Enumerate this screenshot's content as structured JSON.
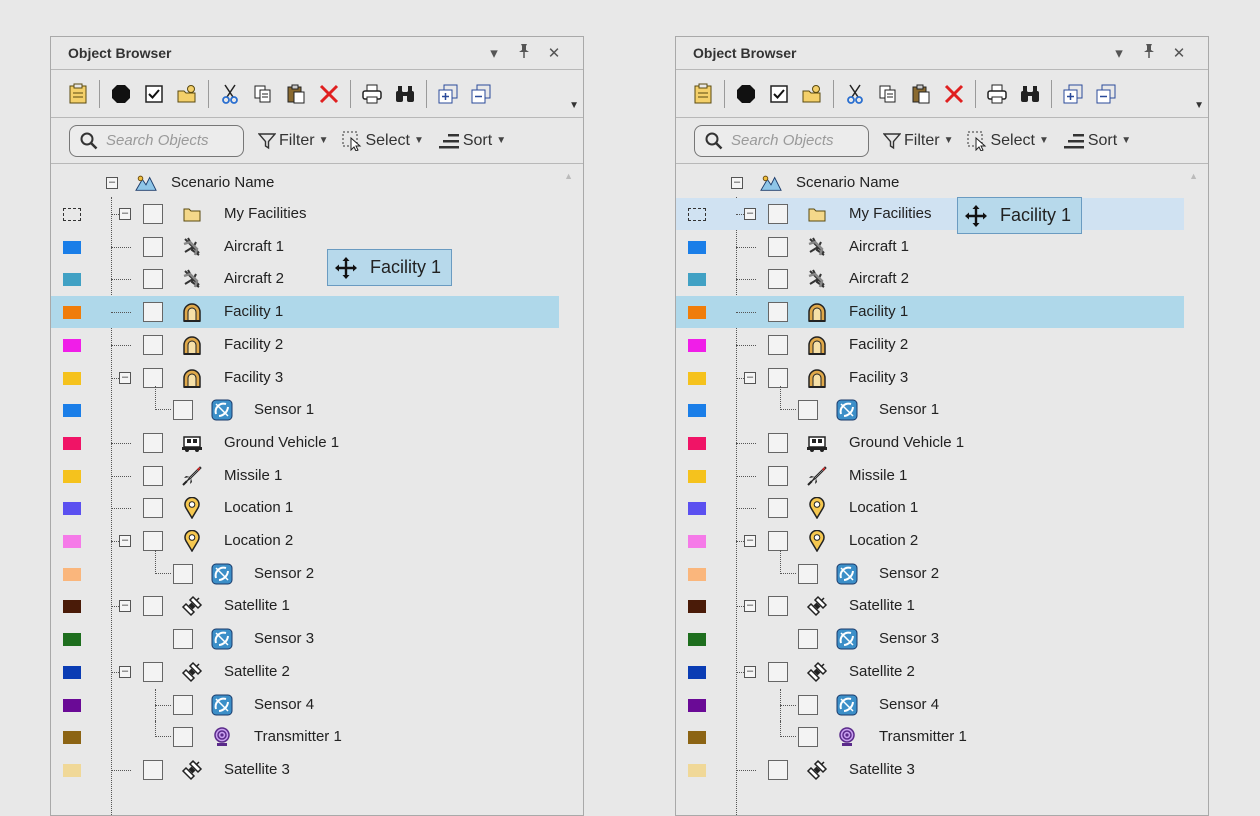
{
  "panels": [
    {
      "title": "Object Browser",
      "search_placeholder": "Search Objects",
      "filter_label": "Filter",
      "select_label": "Select",
      "sort_label": "Sort",
      "drag_label": "Facility 1",
      "hovered_row": null,
      "selected_row": 3
    },
    {
      "title": "Object Browser",
      "search_placeholder": "Search Objects",
      "filter_label": "Filter",
      "select_label": "Select",
      "sort_label": "Sort",
      "drag_label": "Facility 1",
      "hovered_row": 0,
      "selected_row": 3
    }
  ],
  "toolbar_icons": [
    "properties-icon",
    "stop-icon",
    "checkbox-icon",
    "new-folder-icon",
    "cut-icon",
    "copy-icon",
    "paste-icon",
    "delete-icon",
    "print-icon",
    "find-icon",
    "expand-all-icon",
    "collapse-all-icon"
  ],
  "tree": {
    "root": {
      "label": "Scenario Name",
      "icon": "scenario-icon"
    },
    "rows": [
      {
        "label": "My Facilities",
        "icon": "folder-icon",
        "color": "none",
        "level": 1,
        "expander": true
      },
      {
        "label": "Aircraft 1",
        "icon": "aircraft-icon",
        "color": "#1a7ee8",
        "level": 1,
        "expander": false
      },
      {
        "label": "Aircraft 2",
        "icon": "aircraft-icon",
        "color": "#41a1c4",
        "level": 1,
        "expander": false
      },
      {
        "label": "Facility 1",
        "icon": "facility-icon",
        "color": "#f07d0a",
        "level": 1,
        "expander": false
      },
      {
        "label": "Facility 2",
        "icon": "facility-icon",
        "color": "#f01ee8",
        "level": 1,
        "expander": false
      },
      {
        "label": "Facility 3",
        "icon": "facility-icon",
        "color": "#f5c21d",
        "level": 1,
        "expander": true
      },
      {
        "label": "Sensor 1",
        "icon": "sensor-icon",
        "color": "#1a7ee8",
        "level": 2,
        "expander": false,
        "last": true
      },
      {
        "label": "Ground Vehicle 1",
        "icon": "ground-vehicle-icon",
        "color": "#f01466",
        "level": 1,
        "expander": false
      },
      {
        "label": "Missile 1",
        "icon": "missile-icon",
        "color": "#f5c21d",
        "level": 1,
        "expander": false
      },
      {
        "label": "Location 1",
        "icon": "location-icon",
        "color": "#5b50f0",
        "level": 1,
        "expander": false
      },
      {
        "label": "Location 2",
        "icon": "location-icon",
        "color": "#f57ae8",
        "level": 1,
        "expander": true
      },
      {
        "label": "Sensor 2",
        "icon": "sensor-icon",
        "color": "#fab67c",
        "level": 2,
        "expander": false,
        "last": true
      },
      {
        "label": "Satellite 1",
        "icon": "satellite-icon",
        "color": "#4a1b08",
        "level": 1,
        "expander": true
      },
      {
        "label": "Sensor 3",
        "icon": "sensor-icon",
        "color": "#1e6e1e",
        "level": 2,
        "expander": false,
        "nolink": true
      },
      {
        "label": "Satellite 2",
        "icon": "satellite-icon",
        "color": "#0a3cb4",
        "level": 1,
        "expander": true
      },
      {
        "label": "Sensor 4",
        "icon": "sensor-icon",
        "color": "#6a0a96",
        "level": 2,
        "expander": false
      },
      {
        "label": "Transmitter 1",
        "icon": "transmitter-icon",
        "color": "#8c6414",
        "level": 2,
        "expander": false,
        "last": true
      },
      {
        "label": "Satellite 3",
        "icon": "satellite-icon",
        "color": "#f0d898",
        "level": 1,
        "expander": false
      }
    ]
  }
}
